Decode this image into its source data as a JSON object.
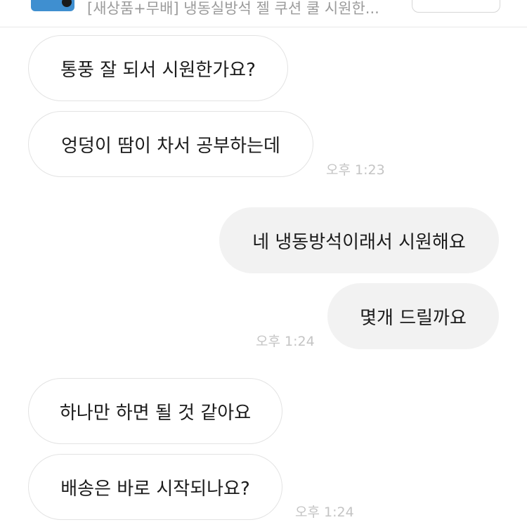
{
  "header": {
    "product_title": "[새상품+무배] 냉동실방석 젤 쿠션 쿨 시원한..."
  },
  "messages": [
    {
      "text": "통풍 잘 되서 시원한가요?",
      "side": "incoming"
    },
    {
      "text": "엉덩이 땀이 차서 공부하는데",
      "side": "incoming"
    },
    {
      "text": "네 냉동방석이래서 시원해요",
      "side": "outgoing"
    },
    {
      "text": "몇개 드릴까요",
      "side": "outgoing"
    },
    {
      "text": "하나만 하면 될 것 같아요",
      "side": "incoming"
    },
    {
      "text": "배송은 바로 시작되나요?",
      "side": "incoming"
    }
  ],
  "timestamps": {
    "group1": "오후 1:23",
    "group2": "오후 1:24",
    "group3": "오후 1:24"
  },
  "colors": {
    "incoming_bubble": "#ffffff",
    "outgoing_bubble": "#f2f2f2",
    "timestamp": "#c4c4c4",
    "message_text": "#1b1b1b"
  }
}
